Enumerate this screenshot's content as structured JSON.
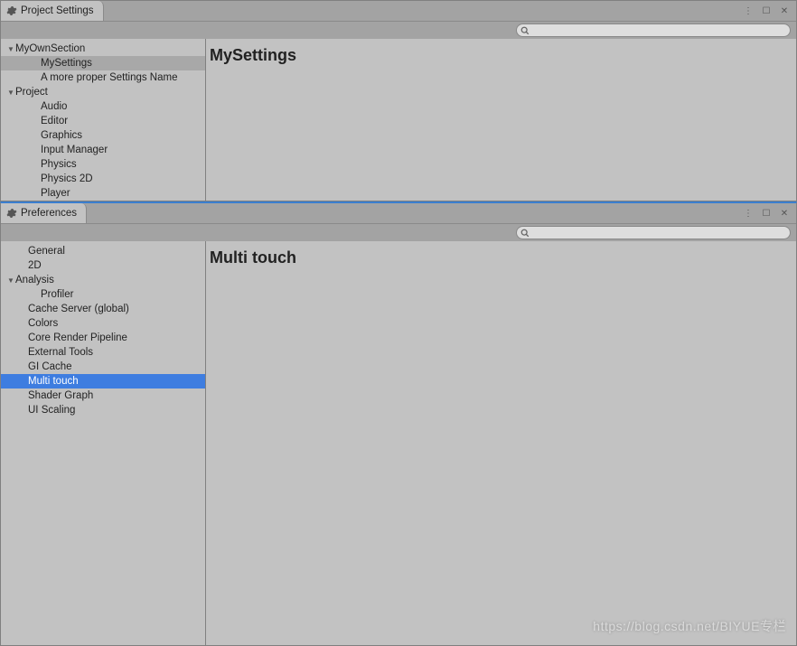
{
  "watermark": "https://blog.csdn.net/BIYUE专栏",
  "panels": {
    "settings": {
      "tab_label": "Project Settings",
      "content_title": "MySettings",
      "tree": [
        {
          "label": "MyOwnSection",
          "depth": 0,
          "arrow": true
        },
        {
          "label": "MySettings",
          "depth": 2,
          "selected": "gray"
        },
        {
          "label": "A more proper Settings Name",
          "depth": 2
        },
        {
          "label": "Project",
          "depth": 0,
          "arrow": true
        },
        {
          "label": "Audio",
          "depth": 2
        },
        {
          "label": "Editor",
          "depth": 2
        },
        {
          "label": "Graphics",
          "depth": 2
        },
        {
          "label": "Input Manager",
          "depth": 2
        },
        {
          "label": "Physics",
          "depth": 2
        },
        {
          "label": "Physics 2D",
          "depth": 2
        },
        {
          "label": "Player",
          "depth": 2
        }
      ]
    },
    "prefs": {
      "tab_label": "Preferences",
      "content_title": "Multi touch",
      "tree": [
        {
          "label": "General",
          "depth": 1
        },
        {
          "label": "2D",
          "depth": 1
        },
        {
          "label": "Analysis",
          "depth": 0,
          "arrow": true
        },
        {
          "label": "Profiler",
          "depth": 2
        },
        {
          "label": "Cache Server (global)",
          "depth": 1
        },
        {
          "label": "Colors",
          "depth": 1
        },
        {
          "label": "Core Render Pipeline",
          "depth": 1
        },
        {
          "label": "External Tools",
          "depth": 1
        },
        {
          "label": "GI Cache",
          "depth": 1
        },
        {
          "label": "Multi touch",
          "depth": 1,
          "selected": "blue"
        },
        {
          "label": "Shader Graph",
          "depth": 1
        },
        {
          "label": "UI Scaling",
          "depth": 1
        }
      ]
    }
  },
  "icons": {
    "menu_dots": "⋮",
    "maximize": "☐",
    "close": "✕"
  }
}
